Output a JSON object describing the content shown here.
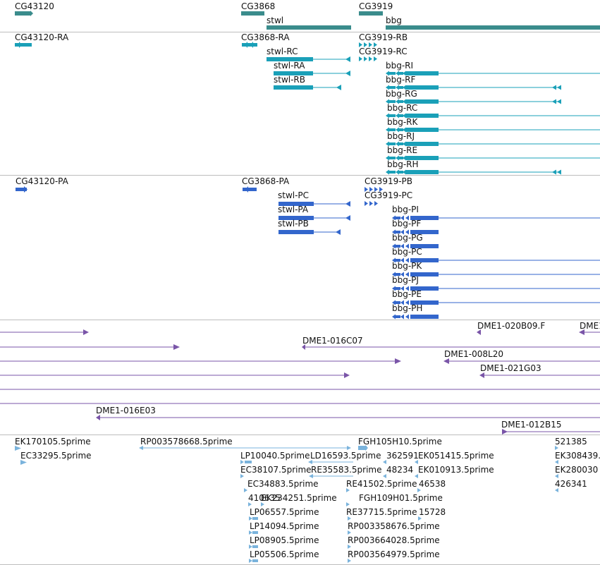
{
  "track_colors": {
    "gene": "#3a8c8c",
    "transcript": "#1aa0b8",
    "protein": "#3366cc",
    "bac": "#7a55a8",
    "est": "#7ab3dc",
    "separator": "#bdbdbd"
  },
  "genes": {
    "cg43120": "CG43120",
    "cg3868": "CG3868",
    "cg3919": "CG3919",
    "stwl": "stwl",
    "bbg": "bbg"
  },
  "transcripts": {
    "cg43120_ra": "CG43120-RA",
    "cg3868_ra": "CG3868-RA",
    "cg3919_rb": "CG3919-RB",
    "cg3919_rc": "CG3919-RC",
    "stwl_rc": "stwl-RC",
    "stwl_ra": "stwl-RA",
    "stwl_rb": "stwl-RB",
    "bbg_ri": "bbg-RI",
    "bbg_rf": "bbg-RF",
    "bbg_rg": "bbg-RG",
    "bbg_rc": "bbg-RC",
    "bbg_rk": "bbg-RK",
    "bbg_rj": "bbg-RJ",
    "bbg_re": "bbg-RE",
    "bbg_rh": "bbg-RH"
  },
  "proteins": {
    "cg43120_pa": "CG43120-PA",
    "cg3868_pa": "CG3868-PA",
    "cg3919_pb": "CG3919-PB",
    "cg3919_pc": "CG3919-PC",
    "stwl_pc": "stwl-PC",
    "stwl_pa": "stwl-PA",
    "stwl_pb": "stwl-PB",
    "bbg_pi": "bbg-PI",
    "bbg_pf": "bbg-PF",
    "bbg_pg": "bbg-PG",
    "bbg_pc": "bbg-PC",
    "bbg_pk": "bbg-PK",
    "bbg_pj": "bbg-PJ",
    "bbg_pe": "bbg-PE",
    "bbg_ph": "bbg-PH"
  },
  "bac": {
    "b020b09": "DME1-020B09.F",
    "bdme_partial": "DME1",
    "b016c07": "DME1-016C07",
    "b008l20": "DME1-008L20",
    "b021g03": "DME1-021G03",
    "b016e03": "DME1-016E03",
    "b012b15": "DME1-012B15"
  },
  "est": {
    "e1": "EK170105.5prime",
    "e2": "EC33295.5prime",
    "e3": "RP003578668.5prime",
    "e4": "FGH105H10.5prime",
    "e5": "521385",
    "e6": "LP10040.5prime",
    "e7": "LD16593.5prime",
    "e8": "362591",
    "e9": "EK051415.5prime",
    "e10": "EK308439.",
    "e11": "EC38107.5prime",
    "e12": "RE35583.5prime",
    "e13": "48234",
    "e14": "EK010913.5prime",
    "e15": "EK280030",
    "e16": "EC34883.5prime",
    "e17": "RE41502.5prime",
    "e18": "46538",
    "e19": "426341",
    "e20": "410635",
    "e21": "EK234251.5prime",
    "e22": "FGH109H01.5prime",
    "e23": "LP06557.5prime",
    "e24": "RE37715.5prime",
    "e25": "15728",
    "e26": "LP14094.5prime",
    "e27": "RP003358676.5prime",
    "e28": "LP08905.5prime",
    "e29": "RP003664028.5prime",
    "e30": "LP05506.5prime",
    "e31": "RP003564979.5prime"
  }
}
